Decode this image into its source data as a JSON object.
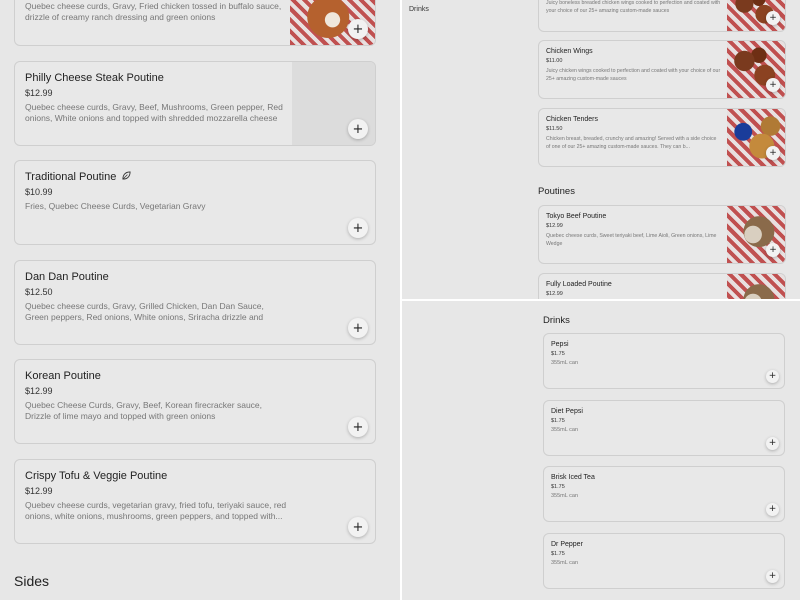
{
  "left_panel": {
    "top_card": {
      "desc": "Quebec cheese curds, Gravy, Fried chicken tossed in buffalo sauce, drizzle of creamy ranch dressing and green onions",
      "add_label": "+"
    },
    "items": [
      {
        "name": "Philly Cheese Steak Poutine",
        "price": "$12.99",
        "desc": "Quebec cheese curds, Gravy, Beef, Mushrooms, Green pepper, Red onions, White onions and topped with shredded mozzarella cheese",
        "add_label": "+"
      },
      {
        "name": "Traditional Poutine",
        "price": "$10.99",
        "desc": "Fries, Quebec Cheese Curds, Vegetarian Gravy",
        "add_label": "+",
        "badge_icon": "leaf-icon"
      },
      {
        "name": "Dan Dan Poutine",
        "price": "$12.50",
        "desc": "Quebec cheese curds, Gravy, Grilled Chicken, Dan Dan Sauce, Green peppers, Red onions, White onions, Sriracha drizzle and Green onio...",
        "add_label": "+"
      },
      {
        "name": "Korean Poutine",
        "price": "$12.99",
        "desc": "Quebec Cheese Curds, Gravy, Beef, Korean firecracker sauce, Drizzle of lime mayo and topped with green onions",
        "add_label": "+"
      },
      {
        "name": "Crispy Tofu & Veggie Poutine",
        "price": "$12.99",
        "desc": "Quebev cheese curds, vegetarian gravy, fried tofu, teriyaki sauce, red onions, white onions, mushrooms, green peppers, and topped with...",
        "add_label": "+"
      }
    ],
    "next_section_title": "Sides"
  },
  "top_right_panel": {
    "sidebar_link": "Drinks",
    "top_card": {
      "desc": "Juicy boneless breaded chicken wings cooked to perfection and coated with your choice of our 25+ amazing custom-made sauces",
      "add_label": "+"
    },
    "items": [
      {
        "name": "Chicken Wings",
        "price": "$11.00",
        "desc": "Juicy chicken wings cooked to perfection and coated with your choice of our 25+ amazing custom-made sauces",
        "add_label": "+"
      },
      {
        "name": "Chicken Tenders",
        "price": "$11.50",
        "desc": "Chicken breast, breaded, crunchy and amazing! Served with a side choice of one of our 25+ amazing custom-made sauces. They can b...",
        "add_label": "+"
      }
    ],
    "section_title": "Poutines",
    "poutines": [
      {
        "name": "Tokyo Beef Poutine",
        "price": "$12.99",
        "desc": "Quebec cheese curds, Sweet teriyaki beef, Lime Aioli, Green onions, Lime Wedge",
        "add_label": "+"
      },
      {
        "name": "Fully Loaded Poutine",
        "price": "$12.99"
      }
    ]
  },
  "bottom_right_panel": {
    "section_title": "Drinks",
    "items": [
      {
        "name": "Pepsi",
        "price": "$1.75",
        "desc": "355mL can",
        "add_label": "+"
      },
      {
        "name": "Diet Pepsi",
        "price": "$1.75",
        "desc": "355mL can",
        "add_label": "+"
      },
      {
        "name": "Brisk Iced Tea",
        "price": "$1.75",
        "desc": "355mL can",
        "add_label": "+"
      },
      {
        "name": "Dr Pepper",
        "price": "$1.75",
        "desc": "355mL can",
        "add_label": "+"
      }
    ]
  }
}
